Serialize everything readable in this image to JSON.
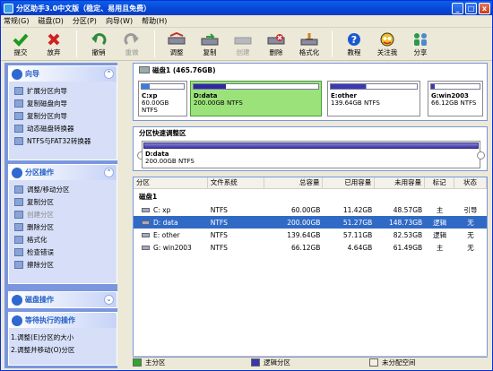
{
  "window": {
    "title": "分区助手3.0中文版（稳定、易用且免费）",
    "min": "_",
    "max": "□",
    "close": "x"
  },
  "menu": [
    "常规(G)",
    "磁盘(D)",
    "分区(P)",
    "向导(W)",
    "帮助(H)"
  ],
  "toolbar": {
    "group1": [
      {
        "label": "提交",
        "icon": "check-icon",
        "color": "#1E9A1E"
      },
      {
        "label": "放弃",
        "icon": "x-icon",
        "color": "#D02020"
      }
    ],
    "group2": [
      {
        "label": "撤销",
        "icon": "undo-icon",
        "color": "#2E8A3E"
      },
      {
        "label": "重做",
        "icon": "redo-icon",
        "color": "#9a9a9a",
        "disabled": true
      }
    ],
    "group3": [
      {
        "label": "调整",
        "icon": "resize-icon",
        "color": "#c03030"
      },
      {
        "label": "复制",
        "icon": "copy-icon",
        "color": "#2d9d43"
      },
      {
        "label": "创建",
        "icon": "create-icon",
        "color": "#9a9a9a",
        "disabled": true
      },
      {
        "label": "删除",
        "icon": "delete-icon",
        "color": "#c03030"
      },
      {
        "label": "格式化",
        "icon": "format-icon",
        "color": "#d08020"
      }
    ],
    "group4": [
      {
        "label": "教程",
        "icon": "help-icon",
        "color": "#1a5ad0"
      },
      {
        "label": "关注我",
        "icon": "follow-icon",
        "color": "#d02020"
      },
      {
        "label": "分享",
        "icon": "share-icon",
        "color": "#2a9a4a"
      }
    ]
  },
  "sidebar": {
    "wizard": {
      "title": "向导",
      "items": [
        "扩展分区向导",
        "复制磁盘向导",
        "复制分区向导",
        "动态磁盘转换器",
        "NTFS与FAT32转换器"
      ]
    },
    "partition_ops": {
      "title": "分区操作",
      "items": [
        {
          "label": "调整/移动分区",
          "enabled": true
        },
        {
          "label": "复制分区",
          "enabled": true
        },
        {
          "label": "创建分区",
          "enabled": false
        },
        {
          "label": "删除分区",
          "enabled": true
        },
        {
          "label": "格式化",
          "enabled": true
        },
        {
          "label": "检查错误",
          "enabled": true
        },
        {
          "label": "擦除分区",
          "enabled": true
        }
      ]
    },
    "disk_ops": {
      "title": "磁盘操作"
    },
    "pending": {
      "title": "等待执行的操作",
      "items": [
        "1.调整(E)分区的大小",
        "2.调整并移动(O)分区"
      ]
    }
  },
  "diskmap": {
    "disk_label": "磁盘1 (465.76GB)",
    "partitions": [
      {
        "name": "C:xp",
        "size": "60.00GB NTFS",
        "fill": 0.19,
        "color": "#3C7DDC",
        "selected": false
      },
      {
        "name": "D:data",
        "size": "200.00GB NTFS",
        "fill": 0.26,
        "color": "#2F2AA0",
        "selected": true
      },
      {
        "name": "E:other",
        "size": "139.64GB NTFS",
        "fill": 0.41,
        "color": "#3C3AB0",
        "selected": false
      },
      {
        "name": "G:win2003",
        "size": "66.12GB NTFS",
        "fill": 0.07,
        "color": "#3C3AB0",
        "selected": false
      }
    ]
  },
  "resize": {
    "title": "分区快速调整区",
    "name": "D:data",
    "size": "200.00GB NTFS"
  },
  "table": {
    "headers": [
      "分区",
      "文件系统",
      "总容量",
      "已用容量",
      "未用容量",
      "标记",
      "状态"
    ],
    "disk": "磁盘1",
    "rows": [
      {
        "part": "C: xp",
        "fs": "NTFS",
        "total": "60.00GB",
        "used": "11.42GB",
        "free": "48.57GB",
        "flag": "主",
        "status": "引导",
        "selected": false
      },
      {
        "part": "D: data",
        "fs": "NTFS",
        "total": "200.00GB",
        "used": "51.27GB",
        "free": "148.73GB",
        "flag": "逻辑",
        "status": "无",
        "selected": true
      },
      {
        "part": "E: other",
        "fs": "NTFS",
        "total": "139.64GB",
        "used": "57.11GB",
        "free": "82.53GB",
        "flag": "逻辑",
        "status": "无",
        "selected": false
      },
      {
        "part": "G: win2003",
        "fs": "NTFS",
        "total": "66.12GB",
        "used": "4.64GB",
        "free": "61.49GB",
        "flag": "主",
        "status": "无",
        "selected": false
      }
    ]
  },
  "legend": [
    {
      "label": "主分区",
      "color": "#2FA52F"
    },
    {
      "label": "逻辑分区",
      "color": "#3A36B0"
    },
    {
      "label": "未分配空间",
      "color": "#F4F0DC"
    }
  ]
}
